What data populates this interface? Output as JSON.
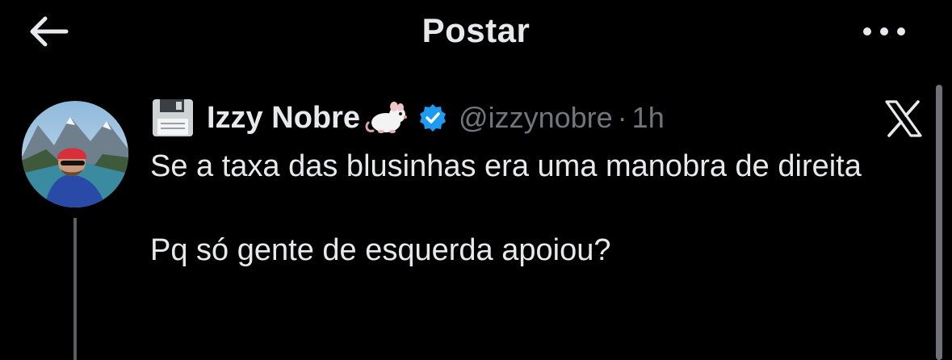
{
  "header": {
    "title": "Postar",
    "back_icon": "arrow-left-icon",
    "more_icon": "more-horizontal-icon"
  },
  "post": {
    "author": {
      "name": "Izzy Nobre",
      "handle": "@izzynobre",
      "separator": "·",
      "time": "1h",
      "name_emojis": [
        "floppy-disk-icon",
        "rat-icon"
      ],
      "verified": true,
      "avatar": "profile-photo"
    },
    "platform_icon": "x-logo-icon",
    "text_lines": [
      "Se a taxa das blusinhas era uma manobra de direita",
      "Pq só gente de esquerda apoiou?"
    ]
  },
  "colors": {
    "background": "#000000",
    "text_primary": "#e7e9ea",
    "text_secondary": "#71767b",
    "verified_blue": "#1d9bf0",
    "thread_line": "#5a5f64"
  }
}
